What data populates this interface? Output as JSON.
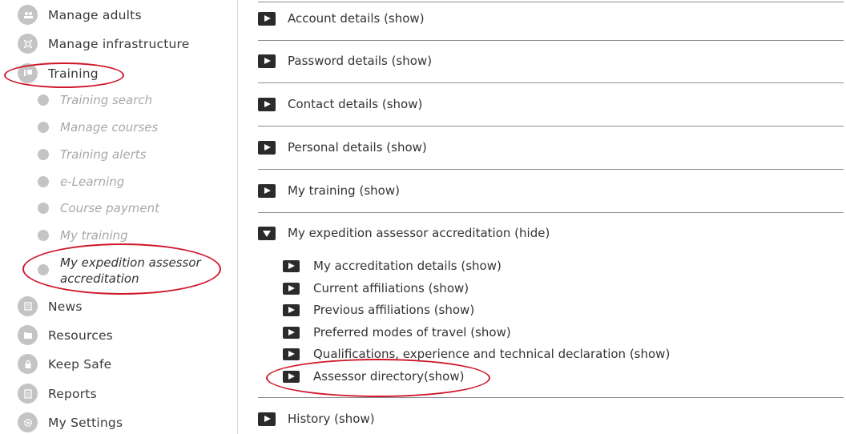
{
  "sidebar": {
    "items": [
      {
        "label": "Manage adults",
        "icon": "adults-icon"
      },
      {
        "label": "Manage infrastructure",
        "icon": "infrastructure-icon"
      },
      {
        "label": "Training",
        "icon": "training-icon"
      },
      {
        "label": "News",
        "icon": "news-icon"
      },
      {
        "label": "Resources",
        "icon": "resources-icon"
      },
      {
        "label": "Keep Safe",
        "icon": "lock-icon"
      },
      {
        "label": "Reports",
        "icon": "reports-icon"
      },
      {
        "label": "My Settings",
        "icon": "gear-icon"
      }
    ],
    "training_sub": [
      "Training search",
      "Manage courses",
      "Training alerts",
      "e-Learning",
      "Course payment",
      "My training",
      "My expedition assessor accreditation"
    ]
  },
  "content": {
    "sections": [
      "Account details (show)",
      "Password details (show)",
      "Contact details (show)",
      "Personal details (show)",
      "My training (show)",
      "My expedition assessor accreditation (hide)",
      "History (show)"
    ],
    "accreditation_sub": [
      "My accreditation details (show)",
      "Current affiliations (show)",
      "Previous affiliations (show)",
      "Preferred modes of travel (show)",
      "Qualifications, experience and technical declaration (show)",
      "Assessor directory(show)"
    ]
  },
  "colors": {
    "highlight": "#d0182a",
    "icon_gray": "#c4c4c4",
    "play_icon": "#2b2b2b"
  }
}
